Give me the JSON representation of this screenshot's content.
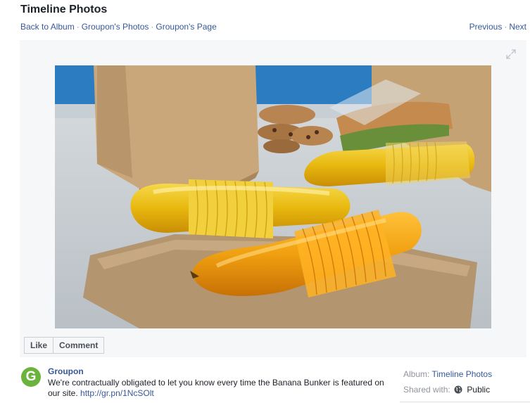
{
  "header": {
    "title": "Timeline Photos",
    "breadcrumbs": [
      "Back to Album",
      "Groupon's Photos",
      "Groupon's Page"
    ],
    "pager": {
      "previous": "Previous",
      "next": "Next"
    }
  },
  "actions": {
    "like": "Like",
    "comment": "Comment"
  },
  "post": {
    "author": "Groupon",
    "avatar_letter": "G",
    "caption": "We're contractually obligated to let you know every time the Banana Bunker is featured on our site. ",
    "link": "http://gr.pn/1NcSOlt"
  },
  "meta": {
    "album_label": "Album:",
    "album_name": "Timeline Photos",
    "shared_label": "Shared with:",
    "privacy": "Public"
  },
  "colors": {
    "link": "#365899",
    "brand_green": "#6ab43e",
    "stage_bg": "#f6f7f9"
  },
  "icons": [
    "expand-icon",
    "globe-icon"
  ]
}
